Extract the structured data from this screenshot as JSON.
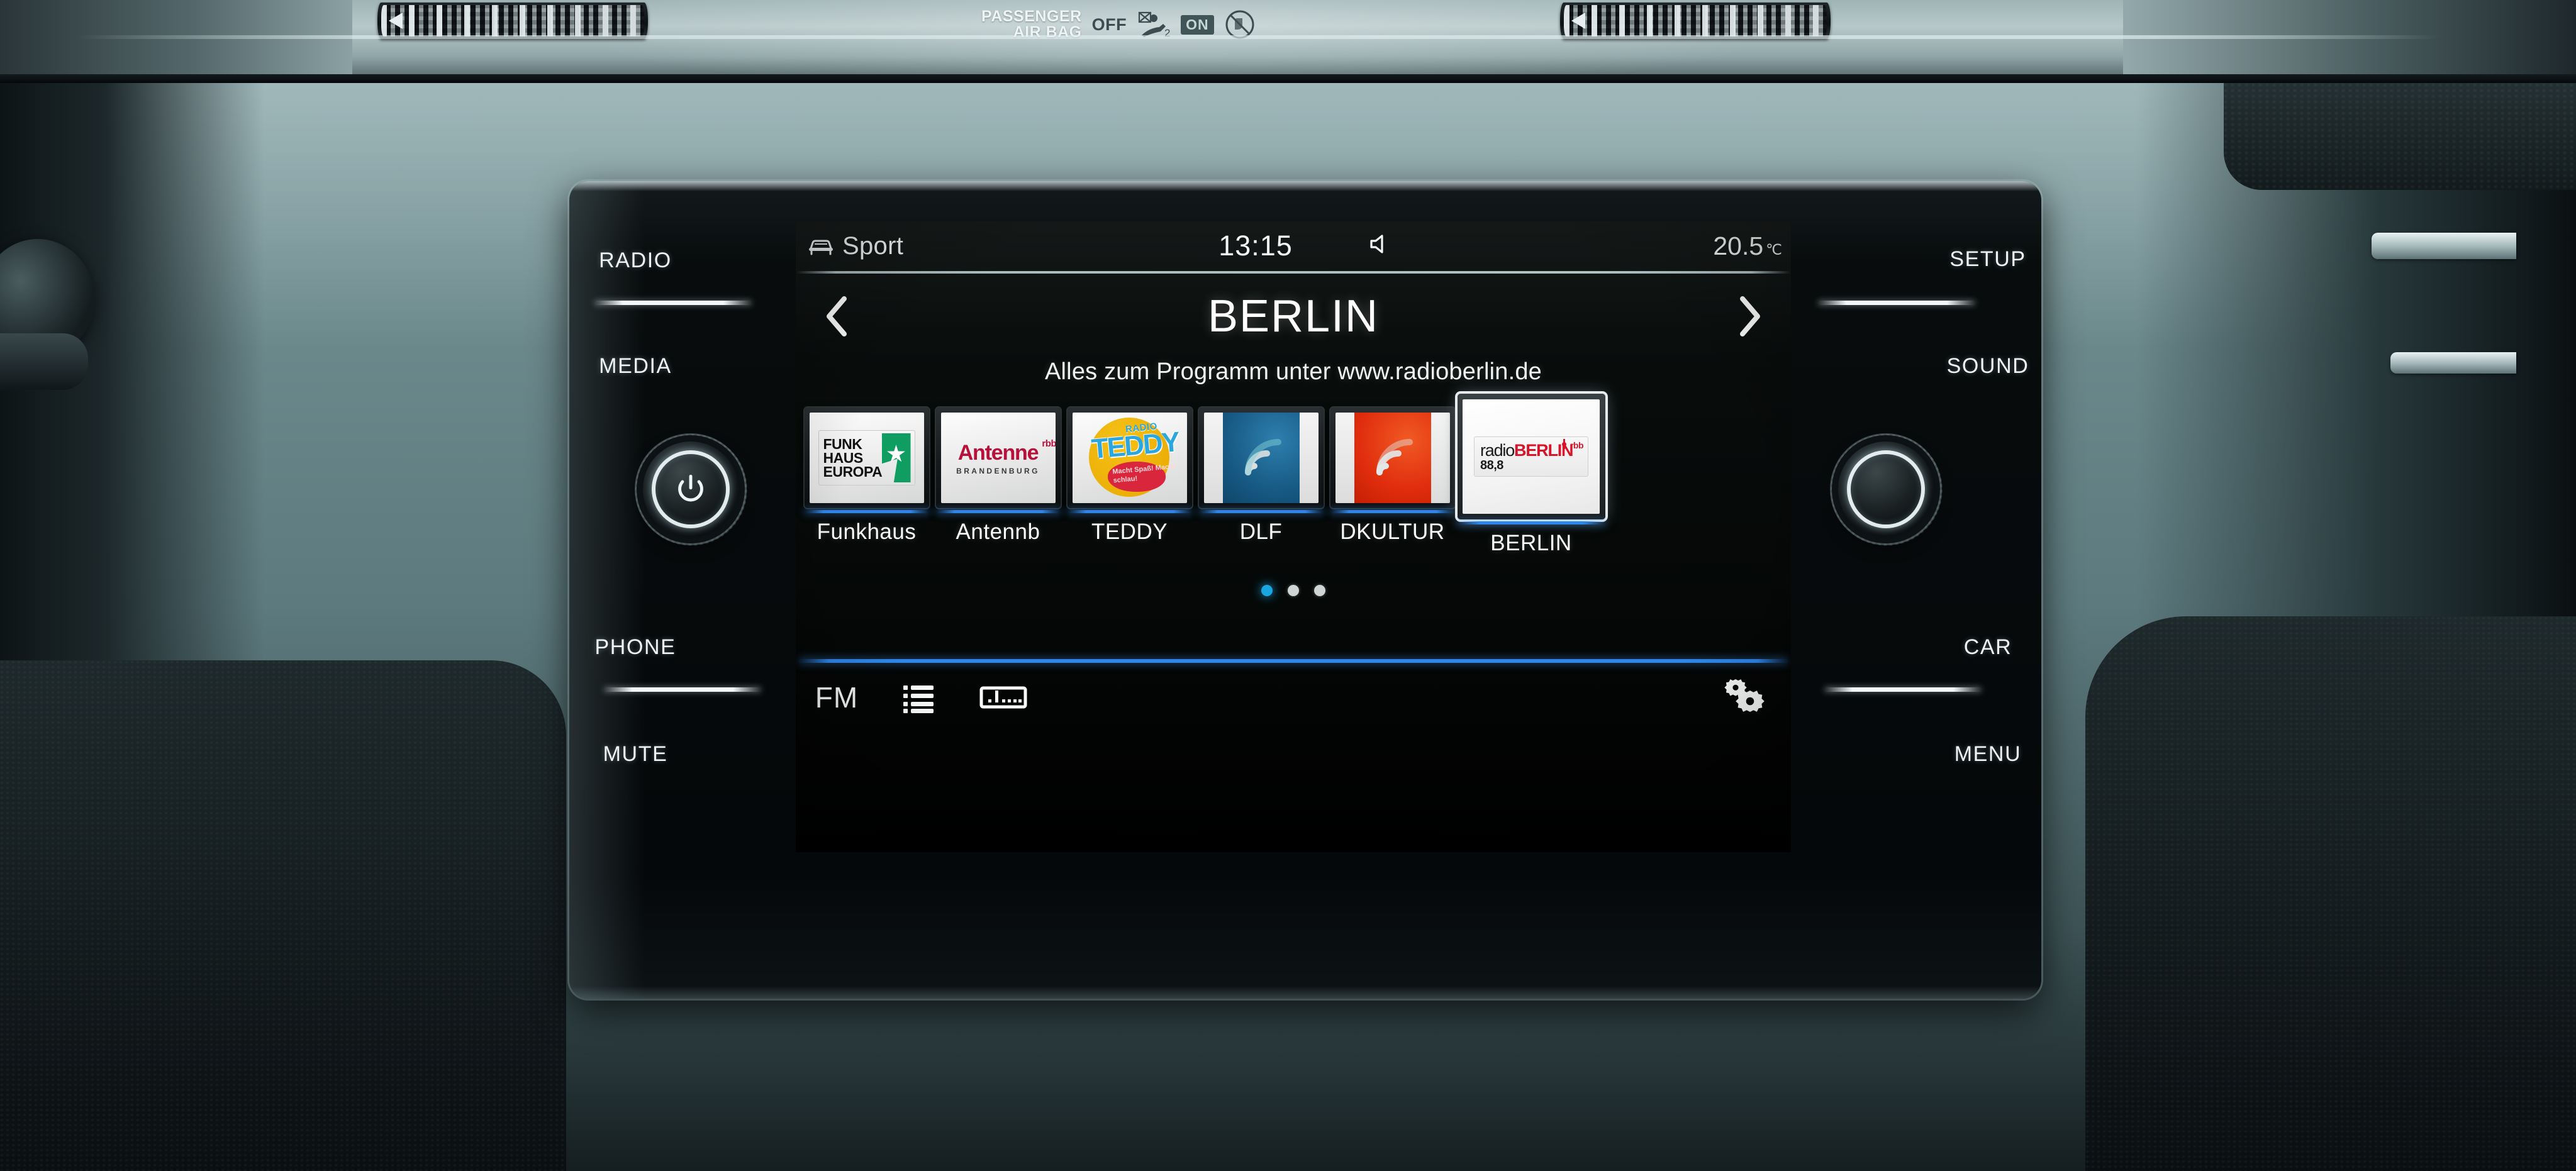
{
  "dashboard": {
    "airbag": {
      "title_line1": "PASSENGER",
      "title_line2": "AIR BAG",
      "off_label": "OFF",
      "on_label": "ON"
    },
    "left_controls": [
      {
        "label": "RADIO"
      },
      {
        "label": "MEDIA"
      },
      {
        "label": "PHONE"
      },
      {
        "label": "MUTE"
      }
    ],
    "right_controls": [
      {
        "label": "SETUP"
      },
      {
        "label": "SOUND"
      },
      {
        "label": "CAR"
      },
      {
        "label": "MENU"
      }
    ],
    "left_knob": "power-knob",
    "right_knob": "tune-knob"
  },
  "screen": {
    "status_bar": {
      "drive_mode": "Sport",
      "drive_mode_icon": "car-icon",
      "time": "13:15",
      "speaker_icon": "speaker-icon",
      "temperature": "20.5",
      "temperature_unit": "℃"
    },
    "station": {
      "name": "BERLIN",
      "prev_icon": "chevron-left-icon",
      "next_icon": "chevron-right-icon",
      "radio_text": "Alles zum Programm unter www.radioberlin.de"
    },
    "presets": [
      {
        "caption": "Funkhaus",
        "logo": "funkhaus-europa-logo",
        "logo_text": {
          "l1": "FUNK",
          "l2": "HAUS",
          "l3": "EUROPA"
        }
      },
      {
        "caption": "Antennb",
        "logo": "antenne-brandenburg-logo",
        "logo_text": {
          "main": "Antenne",
          "sup": "rbb",
          "sub": "BRANDENBURG"
        }
      },
      {
        "caption": "TEDDY",
        "logo": "radio-teddy-logo",
        "logo_text": {
          "radio": "RADIO",
          "name": "TEDDY",
          "slogan": "Macht Spaß!\nMacht schlau!"
        }
      },
      {
        "caption": "DLF",
        "logo": "deutschlandfunk-wave-logo",
        "tile_color": "#175a85"
      },
      {
        "caption": "DKULTUR",
        "logo": "deutschlandfunk-kultur-wave-logo",
        "tile_color": "#e02d0d"
      },
      {
        "caption": "BERLIN",
        "logo": "radio-berlin-rbb-logo",
        "selected": true,
        "logo_text": {
          "a": "radio",
          "b": "BERLIN",
          "sup": "rbb",
          "freq": "88,8"
        }
      }
    ],
    "pagination": {
      "total": 3,
      "active_index": 0
    },
    "bottom_bar": [
      {
        "label": "FM",
        "name": "band-button",
        "type": "text"
      },
      {
        "label": "",
        "name": "station-list-icon",
        "type": "icon"
      },
      {
        "label": "",
        "name": "frequency-band-icon",
        "type": "icon"
      },
      {
        "label": "",
        "name": "settings-gears-icon",
        "type": "icon"
      }
    ]
  },
  "colors": {
    "accent_blue": "#2f86e8",
    "dot_active": "#19a5e0",
    "screen_bg": "#050807",
    "text": "#fafcfc"
  }
}
